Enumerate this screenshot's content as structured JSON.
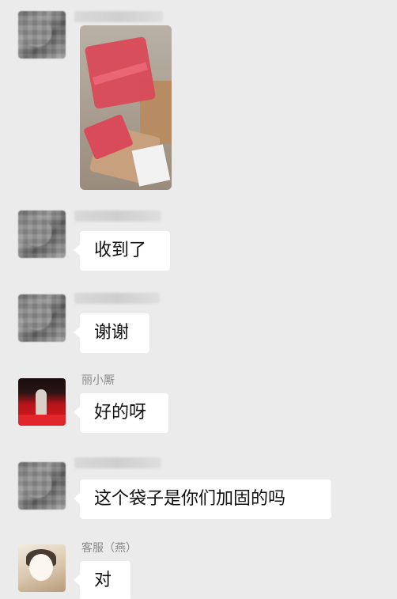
{
  "messages": [
    {
      "type": "image",
      "sender_name": "",
      "text": ""
    },
    {
      "type": "text",
      "sender_name": "",
      "text": "收到了"
    },
    {
      "type": "text",
      "sender_name": "",
      "text": "谢谢"
    },
    {
      "type": "text",
      "sender_name": "丽小厮",
      "text": "好的呀"
    },
    {
      "type": "text",
      "sender_name": "",
      "text": "这个袋子是你们加固的吗"
    },
    {
      "type": "text",
      "sender_name": "客服（燕）",
      "text": "对"
    }
  ],
  "colors": {
    "background": "#ebebeb",
    "bubble": "#ffffff",
    "name": "#888888"
  }
}
